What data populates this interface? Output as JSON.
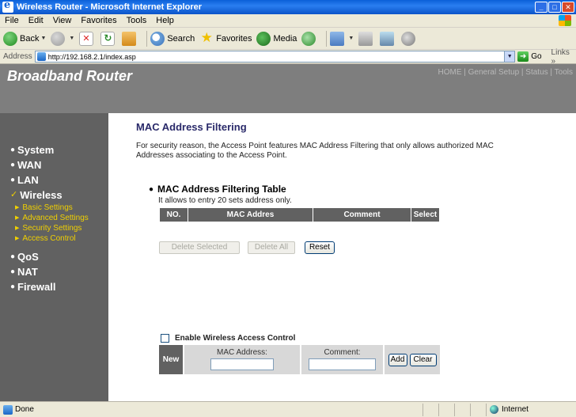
{
  "window": {
    "title": "Wireless Router - Microsoft Internet Explorer",
    "buttons": {
      "minimize": "_",
      "maximize": "□",
      "close": "✕"
    }
  },
  "menu": [
    "File",
    "Edit",
    "View",
    "Favorites",
    "Tools",
    "Help"
  ],
  "toolbar": {
    "back": "Back",
    "search": "Search",
    "favorites": "Favorites",
    "media": "Media"
  },
  "address": {
    "label": "Address",
    "url": "http://192.168.2.1/index.asp",
    "go": "Go",
    "links": "Links"
  },
  "banner": {
    "brand": "Broadband Router",
    "topnav": [
      "HOME",
      "General Setup",
      "Status",
      "Tools"
    ],
    "separator": " | "
  },
  "sidebar": {
    "items": [
      {
        "label": "System",
        "bullet": "●"
      },
      {
        "label": "WAN",
        "bullet": "●"
      },
      {
        "label": "LAN",
        "bullet": "●"
      },
      {
        "label": "Wireless",
        "bullet": "✓",
        "active": true
      },
      {
        "label": "QoS",
        "bullet": "●"
      },
      {
        "label": "NAT",
        "bullet": "●"
      },
      {
        "label": "Firewall",
        "bullet": "●"
      }
    ],
    "subitems": [
      "Basic Settings",
      "Advanced Settings",
      "Security Settings",
      "Access Control"
    ]
  },
  "content": {
    "title": "MAC Address Filtering",
    "description": "For security reason, the Access Point features MAC Address Filtering that only allows authorized MAC Addresses associating to the Access Point.",
    "section_title": "MAC Address Filtering Table",
    "section_sub": "It allows to entry 20 sets address only.",
    "table_headers": [
      "NO.",
      "MAC Addres",
      "Comment",
      "Select"
    ],
    "delete_selected": "Delete Selected",
    "delete_all": "Delete All",
    "reset": "Reset",
    "enable_label": "Enable Wireless Access Control",
    "new_label": "New",
    "mac_label": "MAC Address:",
    "comment_label": "Comment:",
    "add": "Add",
    "clear": "Clear"
  },
  "status": {
    "text": "Done",
    "zone": "Internet"
  },
  "colors": {
    "banner": "#7e7e7e",
    "sidebar": "#616161",
    "accent_yellow": "#f0d000",
    "title_blue": "#2a2a6a"
  }
}
